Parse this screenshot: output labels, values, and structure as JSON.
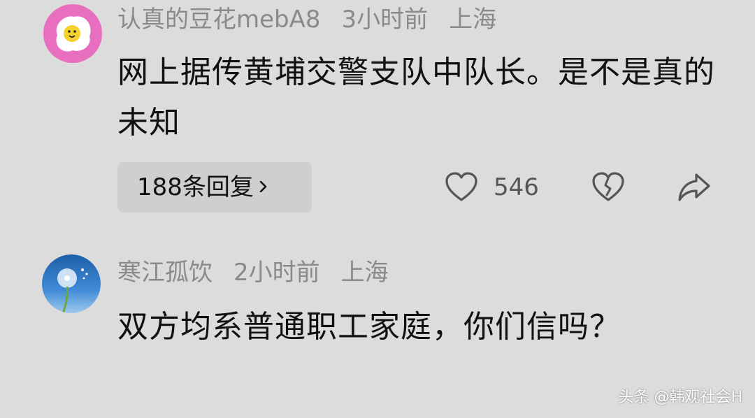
{
  "comments": [
    {
      "username": "认真的豆花mebA8",
      "time": "3小时前",
      "location": "上海",
      "text": "网上据传黄埔交警支队中队长。是不是真的未知",
      "replies_label": "188条回复",
      "likes": "546"
    },
    {
      "username": "寒江孤饮",
      "time": "2小时前",
      "location": "上海",
      "text": "双方均系普通职工家庭，你们信吗？"
    }
  ],
  "watermark": "头条 @韩观社会H",
  "icons": {
    "chevron": "chevron-right-icon",
    "like": "heart-icon",
    "dislike": "broken-heart-icon",
    "share": "share-arrow-icon"
  },
  "colors": {
    "background": "#dcdcdc",
    "meta_text": "#8a8a8a",
    "reply_button_bg": "#cfcfcf",
    "avatar1_ring": "#e86fc0"
  }
}
